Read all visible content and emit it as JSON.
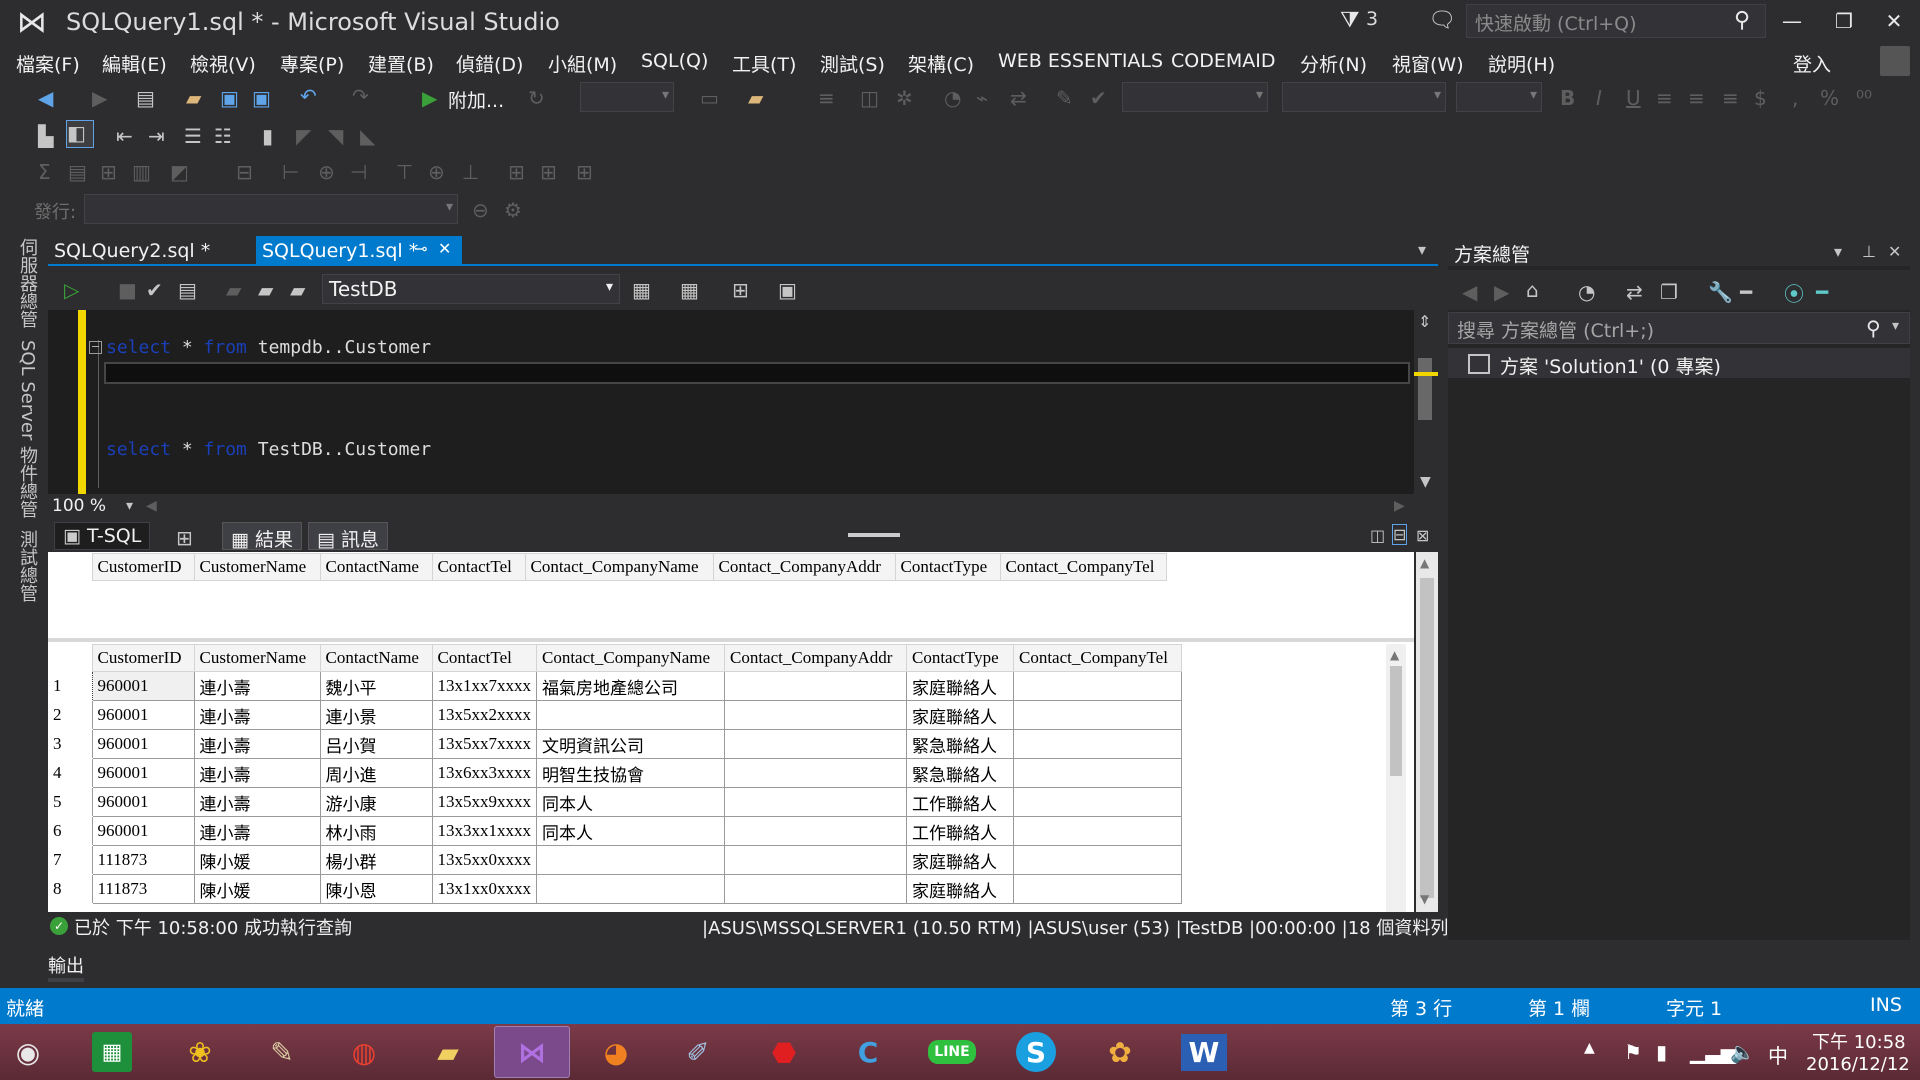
{
  "window": {
    "title": "SQLQuery1.sql * - Microsoft Visual Studio",
    "notification_count": "3",
    "quick_launch_placeholder": "快速啟動 (Ctrl+Q)",
    "sign_in": "登入"
  },
  "menu": [
    "檔案(F)",
    "編輯(E)",
    "檢視(V)",
    "專案(P)",
    "建置(B)",
    "偵錯(D)",
    "小組(M)",
    "SQL(Q)",
    "工具(T)",
    "測試(S)",
    "架構(C)",
    "WEB ESSENTIALS",
    "CODEMAID",
    "分析(N)",
    "視窗(W)",
    "說明(H)"
  ],
  "toolbar": {
    "attach_label": "附加...",
    "publish_label": "發行:"
  },
  "tabs": {
    "query2": "SQLQuery2.sql *",
    "query1": "SQLQuery1.sql *"
  },
  "editor": {
    "database": "TestDB",
    "lines": [
      {
        "kw1": "select",
        "star": " * ",
        "kw2": "from",
        "rest": " tempdb..Customer"
      },
      {
        "kw1": "select",
        "star": " * ",
        "kw2": "from",
        "rest": " TestDB..Customer"
      }
    ],
    "zoom": "100 %"
  },
  "result_tabs": {
    "tsql": "T-SQL",
    "results": "結果",
    "messages": "訊息"
  },
  "grid1": {
    "columns": [
      "CustomerID",
      "CustomerName",
      "ContactName",
      "ContactTel",
      "Contact_CompanyName",
      "Contact_CompanyAddr",
      "ContactType",
      "Contact_CompanyTel"
    ]
  },
  "grid2": {
    "columns": [
      "CustomerID",
      "CustomerName",
      "ContactName",
      "ContactTel",
      "Contact_CompanyName",
      "Contact_CompanyAddr",
      "ContactType",
      "Contact_CompanyTel"
    ],
    "rows": [
      [
        "1",
        "960001",
        "連小壽",
        "魏小平",
        "13x1xx7xxxx",
        "福氣房地產總公司",
        "",
        "家庭聯絡人",
        ""
      ],
      [
        "2",
        "960001",
        "連小壽",
        "連小景",
        "13x5xx2xxxx",
        "",
        "",
        "家庭聯絡人",
        ""
      ],
      [
        "3",
        "960001",
        "連小壽",
        "吕小賀",
        "13x5xx7xxxx",
        "文明資訊公司",
        "",
        "緊急聯絡人",
        ""
      ],
      [
        "4",
        "960001",
        "連小壽",
        "周小進",
        "13x6xx3xxxx",
        "明智生技協會",
        "",
        "緊急聯絡人",
        ""
      ],
      [
        "5",
        "960001",
        "連小壽",
        "游小康",
        "13x5xx9xxxx",
        "同本人",
        "",
        "工作聯絡人",
        ""
      ],
      [
        "6",
        "960001",
        "連小壽",
        "林小雨",
        "13x3xx1xxxx",
        "同本人",
        "",
        "工作聯絡人",
        ""
      ],
      [
        "7",
        "111873",
        "陳小媛",
        "楊小群",
        "13x5xx0xxxx",
        "",
        "",
        "家庭聯絡人",
        ""
      ],
      [
        "8",
        "111873",
        "陳小媛",
        "陳小恩",
        "13x1xx0xxxx",
        "",
        "",
        "家庭聯絡人",
        ""
      ]
    ]
  },
  "query_status": {
    "message": "已於 下午 10:58:00 成功執行查詢",
    "connection": "|ASUS\\MSSQLSERVER1 (10.50 RTM) |ASUS\\user (53) |TestDB |00:00:00 |18 個資料列"
  },
  "output_label": "輸出",
  "solution_explorer": {
    "title": "方案總管",
    "search_placeholder": "搜尋 方案總管 (Ctrl+;)",
    "root": "方案 'Solution1' (0 專案)"
  },
  "side_tabs": [
    "伺服器總管",
    "SQL Server 物件總管",
    "測試總管"
  ],
  "statusbar": {
    "ready": "就緒",
    "line": "第 3 行",
    "col": "第 1 欄",
    "char": "字元 1",
    "mode": "INS"
  },
  "taskbar": {
    "time": "下午 10:58",
    "date": "2016/12/12",
    "ime": "中"
  },
  "colors": {
    "accent": "#007acc",
    "background": "#2d2d30",
    "editor_bg": "#1e1e1e",
    "keyword": "#1a3fb8",
    "margin_marker": "#f2d600"
  }
}
